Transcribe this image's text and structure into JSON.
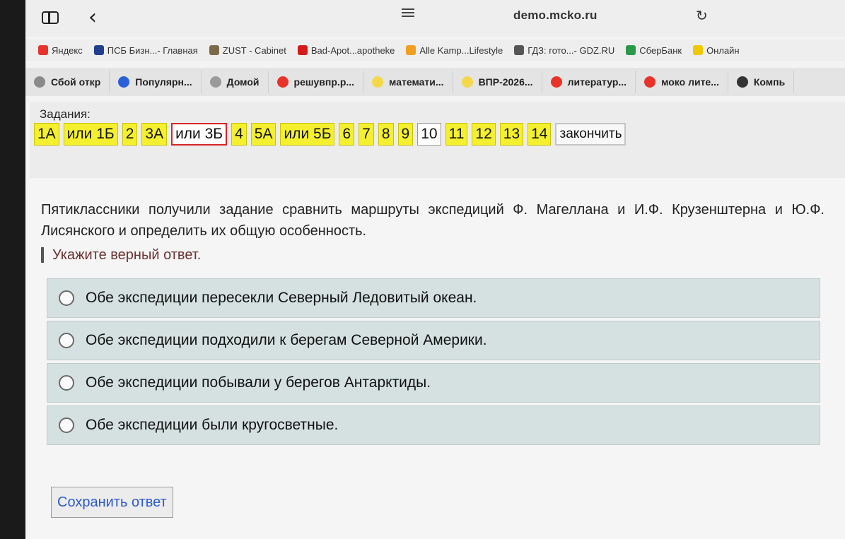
{
  "browser": {
    "url": "demo.mcko.ru",
    "favorites": [
      {
        "label": "Яндекс",
        "icon": "yandex-icon",
        "color": "#e8332a"
      },
      {
        "label": "ПСБ Бизн...- Главная",
        "icon": "psb-icon",
        "color": "#1f3f8f"
      },
      {
        "label": "ZUST - Cabinet",
        "icon": "zust-icon",
        "color": "#7a6a4a"
      },
      {
        "label": "Bad-Apot...apotheke",
        "icon": "amazon-icon",
        "color": "#d41a1a"
      },
      {
        "label": "Alle Kamp...Lifestyle",
        "icon": "tag-icon",
        "color": "#f0a020"
      },
      {
        "label": "ГДЗ: гото...- GDZ.RU",
        "icon": "gdz-icon",
        "color": "#555555"
      },
      {
        "label": "СберБанк",
        "icon": "sber-icon",
        "color": "#2a9a4a"
      },
      {
        "label": "Онлайн",
        "icon": "tbank-icon",
        "color": "#f0c800"
      }
    ],
    "tabs": [
      {
        "label": "Сбой откр",
        "icon": "doc-icon",
        "color": "#8a8a8a"
      },
      {
        "label": "Популярн...",
        "icon": "ozon-icon",
        "color": "#2b5fd9"
      },
      {
        "label": "Домой",
        "icon": "m-icon",
        "color": "#9a9a9a"
      },
      {
        "label": "решувпр.р...",
        "icon": "yandex-icon",
        "color": "#e8332a"
      },
      {
        "label": "математи...",
        "icon": "sun-icon",
        "color": "#f4d84a"
      },
      {
        "label": "ВПР-2026...",
        "icon": "sun-icon",
        "color": "#f4d84a"
      },
      {
        "label": "литератур...",
        "icon": "yandex-icon",
        "color": "#e8332a"
      },
      {
        "label": "моко лите...",
        "icon": "yandex-icon",
        "color": "#e8332a"
      },
      {
        "label": "Компь",
        "icon": "close-icon",
        "color": "#333333"
      }
    ]
  },
  "tasks": {
    "label": "Задания:",
    "items": [
      "1А",
      "или 1Б",
      "2",
      "3А",
      "или 3Б",
      "4",
      "5А",
      "или 5Б",
      "6",
      "7",
      "8",
      "9",
      "10",
      "11",
      "12",
      "13",
      "14"
    ],
    "current": "или 3Б",
    "unmarked": [
      "10"
    ],
    "finish_label": "закончить"
  },
  "question": {
    "text": "Пятиклассники получили задание сравнить маршруты экспедиций Ф. Магеллана и И.Ф. Крузенштерна и Ю.Ф. Лисянского и определить их общую особенность.",
    "hint": "Укажите верный ответ.",
    "options": [
      "Обе экспедиции пересекли Северный Ледовитый океан.",
      "Обе экспедиции подходили к берегам Северной Америки.",
      "Обе экспедиции побывали у берегов Антарктиды.",
      "Обе экспедиции были кругосветные."
    ]
  },
  "save_label": "Сохранить ответ"
}
